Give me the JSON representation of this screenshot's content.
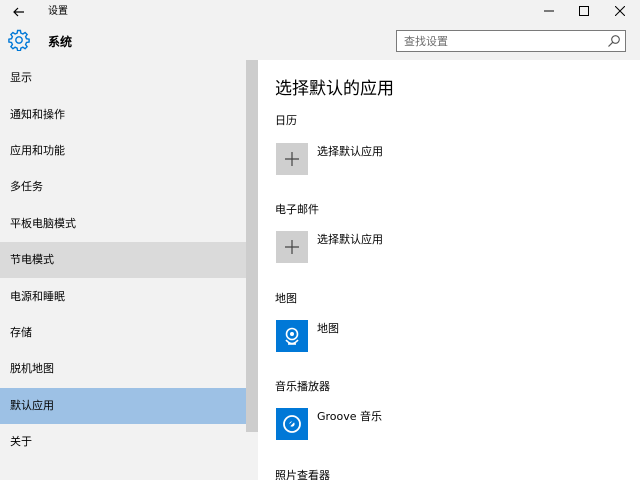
{
  "window": {
    "title": "设置",
    "back_icon": "back-arrow-icon",
    "controls": [
      "minimize-icon",
      "maximize-icon",
      "close-icon"
    ]
  },
  "header": {
    "icon": "gear-icon",
    "title": "系统",
    "search_placeholder": "查找设置",
    "search_icon": "search-icon"
  },
  "sidebar": {
    "items": [
      {
        "label": "显示"
      },
      {
        "label": "通知和操作"
      },
      {
        "label": "应用和功能"
      },
      {
        "label": "多任务"
      },
      {
        "label": "平板电脑模式"
      },
      {
        "label": "节电模式",
        "state": "hover"
      },
      {
        "label": "电源和睡眠"
      },
      {
        "label": "存储"
      },
      {
        "label": "脱机地图"
      },
      {
        "label": "默认应用",
        "state": "selected"
      },
      {
        "label": "关于"
      }
    ]
  },
  "main": {
    "title": "选择默认的应用",
    "sections": [
      {
        "label": "日历",
        "app": "选择默认应用",
        "icon": "plus-icon"
      },
      {
        "label": "电子邮件",
        "app": "选择默认应用",
        "icon": "plus-icon"
      },
      {
        "label": "地图",
        "app": "地图",
        "icon": "maps-icon"
      },
      {
        "label": "音乐播放器",
        "app": "Groove 音乐",
        "icon": "groove-music-icon"
      },
      {
        "label": "照片查看器"
      }
    ]
  },
  "colors": {
    "accent": "#0078d7",
    "selected": "#9dc1e5",
    "hover": "#dadada",
    "sidebar_bg": "#f2f2f2",
    "tile_gray": "#cfcfcf"
  }
}
